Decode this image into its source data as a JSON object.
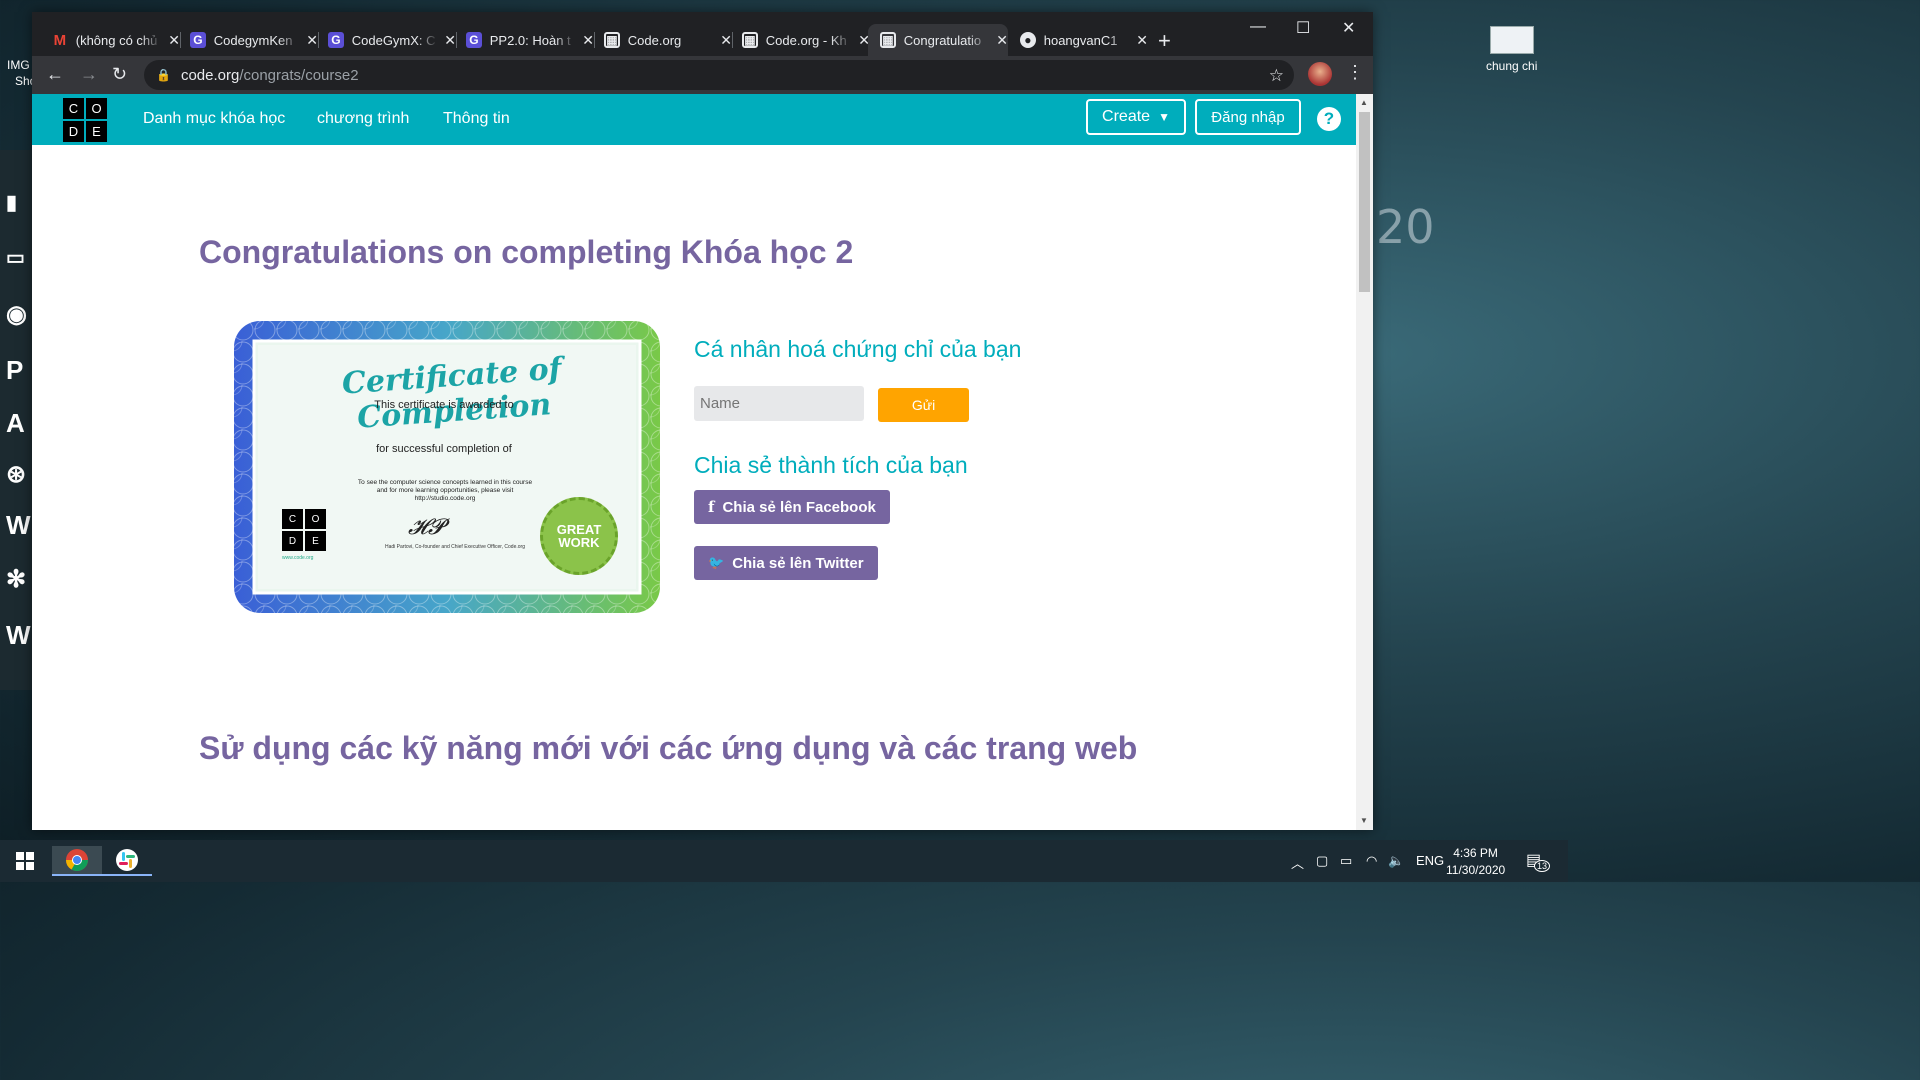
{
  "desktop": {
    "left_labels": [
      "IMG",
      "Sho"
    ],
    "left_icons": [
      "P",
      "A",
      "W",
      "W"
    ],
    "right_icon_label": "chung chi",
    "deco_text": "20"
  },
  "browser": {
    "tabs": [
      {
        "title": "(không có chủ",
        "favicon": "gmail-icon"
      },
      {
        "title": "CodegymKen",
        "favicon": "codegym-icon"
      },
      {
        "title": "CodeGymX: C",
        "favicon": "codegym-icon"
      },
      {
        "title": "PP2.0: Hoàn t",
        "favicon": "codegym-icon"
      },
      {
        "title": "Code.org",
        "favicon": "codeorg-icon"
      },
      {
        "title": "Code.org - Kh",
        "favicon": "codeorg-icon"
      },
      {
        "title": "Congratulatio",
        "favicon": "codeorg-icon",
        "active": true
      },
      {
        "title": "hoangvanC1",
        "favicon": "github-icon"
      }
    ],
    "url_host": "code.org",
    "url_path": "/congrats/course2"
  },
  "page": {
    "nav": {
      "links": [
        "Danh mục khóa học",
        "chương trình",
        "Thông tin"
      ],
      "create_label": "Create",
      "login_label": "Đăng nhập",
      "help": "?"
    },
    "heading": "Congratulations on completing Khóa học 2",
    "certificate": {
      "title": "Certificate of Completion",
      "awarded": "This certificate is awarded to",
      "completion": "for successful completion of",
      "small1": "To see the computer science concepts learned in this course",
      "small2": "and for more learning opportunities, please visit",
      "small3": "http://studio.code.org",
      "signer": "Hadi Partovi, Co-founder and Chief Executive Officer, Code.org",
      "site": "www.code.org",
      "badge1": "GREAT",
      "badge2": "WORK",
      "logo": [
        "C",
        "O",
        "D",
        "E"
      ]
    },
    "personalize_title": "Cá nhân hoá chứng chỉ của bạn",
    "name_placeholder": "Name",
    "submit_label": "Gửi",
    "share_title": "Chia sẻ thành tích của bạn",
    "facebook_label": "Chia sẻ lên Facebook",
    "twitter_label": "Chia sẻ lên Twitter",
    "bottom_heading": "Sử dụng các kỹ năng mới với các ứng dụng và các trang web"
  },
  "taskbar": {
    "lang": "ENG",
    "time": "4:36 PM",
    "date": "11/30/2020",
    "notifications": "13"
  },
  "colors": {
    "brand_teal": "#00adbc",
    "brand_purple": "#7665a0",
    "accent_orange": "#ffa400"
  }
}
